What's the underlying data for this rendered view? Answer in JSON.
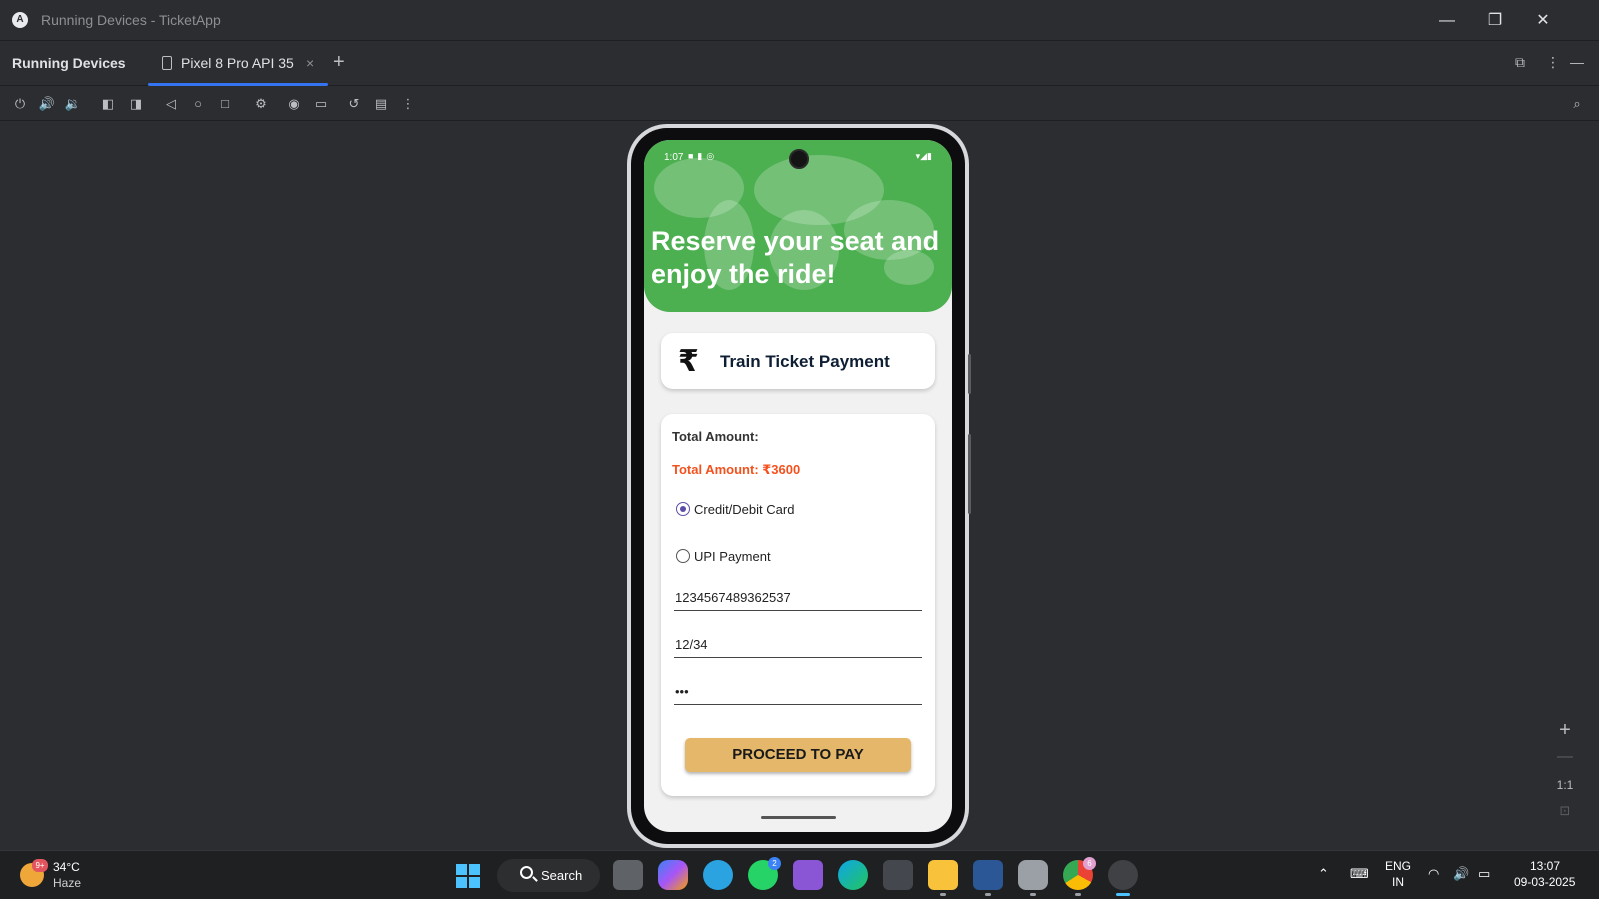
{
  "window": {
    "title": "Running Devices - TicketApp",
    "app_icon": "android-studio-icon"
  },
  "tabbar": {
    "panel_title": "Running Devices",
    "device_tab_label": "Pixel 8 Pro API 35",
    "close_glyph": "×",
    "add_glyph": "+"
  },
  "toolbar": {
    "icons": [
      "power-icon",
      "volume-up-icon",
      "volume-down-icon",
      "rotate-left-icon",
      "rotate-right-icon",
      "back-icon",
      "home-icon",
      "overview-icon",
      "device-settings-icon",
      "screenshot-icon",
      "screen-record-icon",
      "reset-icon",
      "snapshot-icon",
      "more-icon"
    ]
  },
  "phone": {
    "status_time": "1:07",
    "hero_title": "Reserve your seat and enjoy the ride!",
    "payment_card": {
      "icon": "rupee-icon",
      "icon_glyph": "₹",
      "title": "Train Ticket Payment"
    },
    "form": {
      "total_label": "Total Amount:",
      "total_amount": "Total Amount: ₹3600",
      "payment_methods": [
        {
          "label": "Credit/Debit Card",
          "selected": true
        },
        {
          "label": "UPI Payment",
          "selected": false
        }
      ],
      "card_number": "1234567489362537",
      "expiry": "12/34",
      "cvv_masked": "•••",
      "button_label": "PROCEED TO PAY"
    },
    "colors": {
      "hero_green": "#4caf50",
      "amount_orange": "#f4511e",
      "button_gold": "#e4b76a",
      "radio_purple": "#5e4da8"
    }
  },
  "zoom": {
    "zoom_in": "+",
    "zoom_out": "—",
    "actual_size": "1:1"
  },
  "taskbar": {
    "weather_badge": "9+",
    "temperature": "34°C",
    "condition": "Haze",
    "search_label": "Search",
    "whatsapp_badge": "2",
    "chrome_badge": "6",
    "language_top": "ENG",
    "language_bottom": "IN",
    "time": "13:07",
    "date": "09-03-2025"
  }
}
